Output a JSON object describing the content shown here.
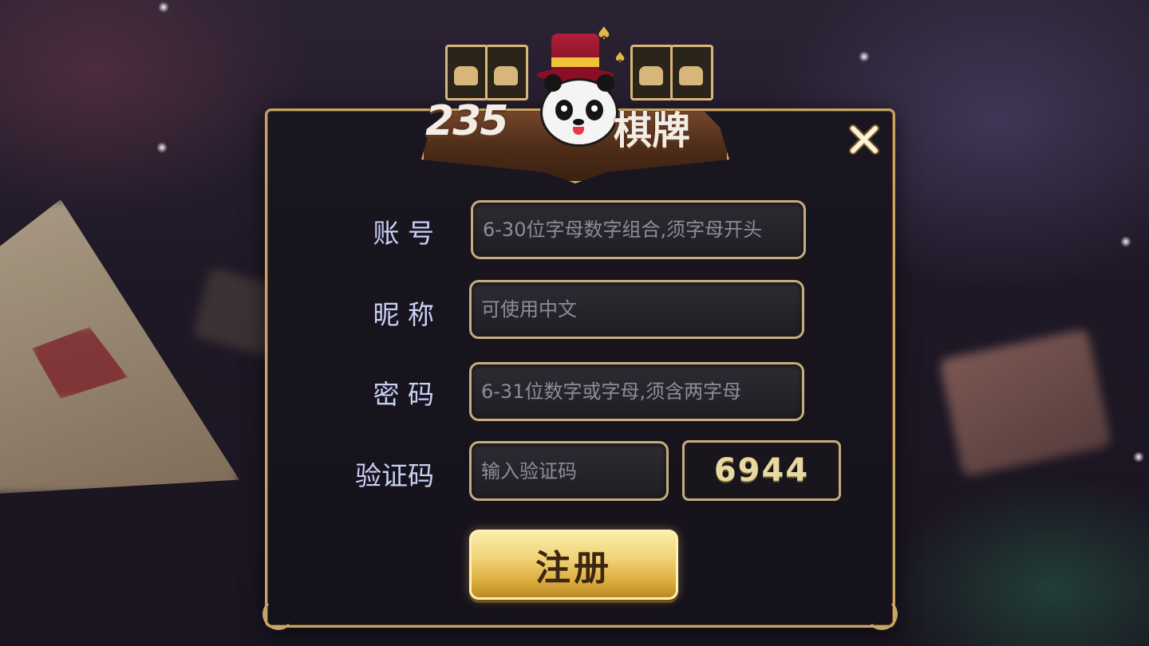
{
  "logo": {
    "brand_number": "235",
    "brand_name": "棋牌",
    "icons": [
      "panda-icon",
      "top-hat-icon",
      "spade-icon",
      "card-icon"
    ]
  },
  "close_button": {
    "icon": "close-icon"
  },
  "form": {
    "account": {
      "label": "账 号",
      "placeholder": "6-30位字母数字组合,须字母开头",
      "value": ""
    },
    "nickname": {
      "label": "昵 称",
      "placeholder": "可使用中文",
      "value": ""
    },
    "password": {
      "label": "密 码",
      "placeholder": "6-31位数字或字母,须含两字母",
      "value": ""
    },
    "captcha": {
      "label": "验证码",
      "placeholder": "输入验证码",
      "value": "",
      "code": "6944"
    }
  },
  "register_button": {
    "label": "注册"
  },
  "colors": {
    "accent_gold": "#c9a467",
    "label_text": "#c9d0f5",
    "button_gold": "#f1d377",
    "panel_bg": "#1a1620"
  }
}
